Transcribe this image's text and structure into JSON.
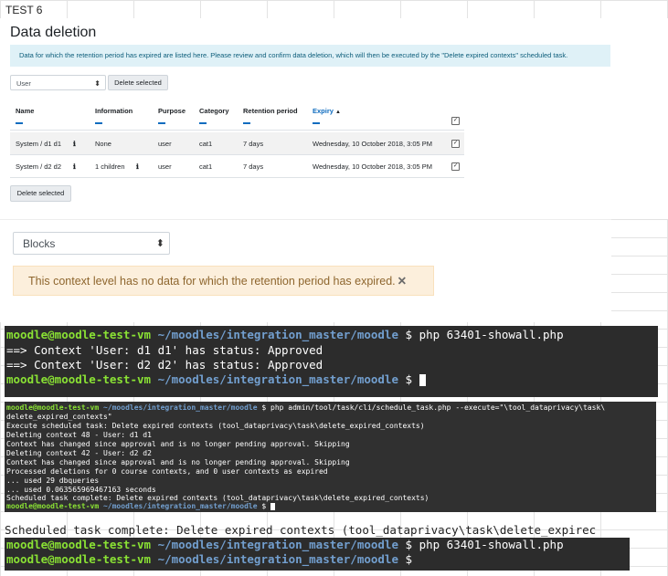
{
  "test_label": "TEST 6",
  "page": {
    "title": "Data deletion",
    "info_banner": "Data for which the retention period has expired are listed here. Please review and confirm data deletion, which will then be executed by the \"Delete expired contexts\" scheduled task."
  },
  "filter": {
    "context_select": "User",
    "delete_selected_label": "Delete selected"
  },
  "table": {
    "headers": {
      "name": "Name",
      "information": "Information",
      "purpose": "Purpose",
      "category": "Category",
      "retention_period": "Retention period",
      "expiry": "Expiry"
    },
    "expiry_sort_icon": "sort-ascending-icon",
    "rows": [
      {
        "name": "System / d1 d1",
        "information": "None",
        "purpose": "user",
        "category": "cat1",
        "retention_period": "7 days",
        "expiry": "Wednesday, 10 October 2018, 3:05 PM",
        "checked": true
      },
      {
        "name": "System / d2 d2",
        "information": "1 children",
        "purpose": "user",
        "category": "cat1",
        "retention_period": "7 days",
        "expiry": "Wednesday, 10 October 2018, 3:05 PM",
        "checked": true
      }
    ],
    "footer_button": "Delete selected"
  },
  "blocks_section": {
    "context_select": "Blocks",
    "alert": "This context level has no data for which the retention period has expired.",
    "close_icon": "close-icon"
  },
  "terminal1": {
    "prompt_user": "moodle@moodle-test-vm",
    "path": "~/moodles/integration_master/moodle",
    "command": "$ php 63401-showall.php",
    "output": [
      "==> Context 'User: d1 d1' has status: Approved",
      "==> Context 'User: d2 d2' has status: Approved"
    ],
    "last_prompt_suffix": "$"
  },
  "terminal2": {
    "prompt_user": "moodle@moodle-test-vm",
    "path": "~/moodles/integration_master/moodle",
    "command": "$ php admin/tool/task/cli/schedule_task.php --execute=\"\\tool_dataprivacy\\task\\",
    "lines": [
      "delete_expired_contexts\"",
      "Execute scheduled task: Delete expired contexts (tool_dataprivacy\\task\\delete_expired_contexts)",
      "Deleting context 48 - User: d1 d1",
      "  Context has changed since approval and is no longer pending approval. Skipping",
      "Deleting context 42 - User: d2 d2",
      "  Context has changed since approval and is no longer pending approval. Skipping",
      "Processed deletions for 0 course contexts, and 0 user contexts as expired",
      "... used 29 dbqueries",
      "... used 0.063565969467163 seconds",
      "Scheduled task complete: Delete expired contexts (tool_dataprivacy\\task\\delete_expired_contexts)"
    ],
    "last_prompt_suffix": "$"
  },
  "ghost_line": "Scheduled task complete: Delete expired contexts (tool_dataprivacy\\task\\delete_expirec",
  "terminal3": {
    "prompt_user": "moodle@moodle-test-vm",
    "path": "~/moodles/integration_master/moodle",
    "command": "$ php 63401-showall.php",
    "second_prompt_suffix": "$"
  },
  "colors": {
    "terminal_bg": "#2c2c2c",
    "prompt_green": "#8ae234",
    "path_blue": "#729fcf",
    "info_bg": "#dff1f7",
    "warning_bg": "#fcefdc",
    "link_blue": "#0f6cbf"
  }
}
